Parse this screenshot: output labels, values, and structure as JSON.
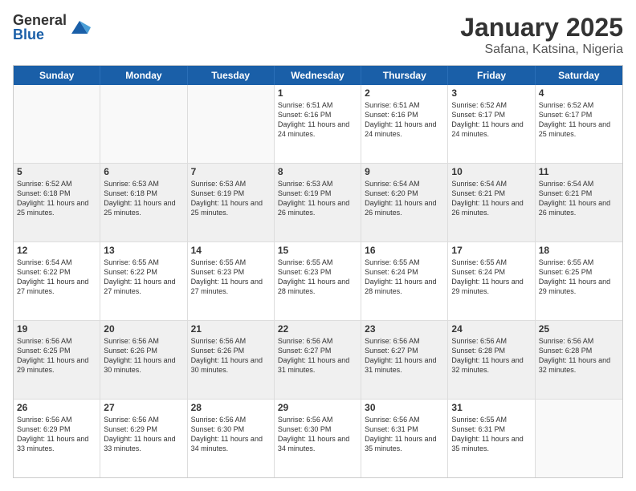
{
  "header": {
    "logo_general": "General",
    "logo_blue": "Blue",
    "main_title": "January 2025",
    "sub_title": "Safana, Katsina, Nigeria"
  },
  "days_of_week": [
    "Sunday",
    "Monday",
    "Tuesday",
    "Wednesday",
    "Thursday",
    "Friday",
    "Saturday"
  ],
  "weeks": [
    [
      {
        "day": "",
        "sunrise": "",
        "sunset": "",
        "daylight": "",
        "empty": true
      },
      {
        "day": "",
        "sunrise": "",
        "sunset": "",
        "daylight": "",
        "empty": true
      },
      {
        "day": "",
        "sunrise": "",
        "sunset": "",
        "daylight": "",
        "empty": true
      },
      {
        "day": "1",
        "sunrise": "Sunrise: 6:51 AM",
        "sunset": "Sunset: 6:16 PM",
        "daylight": "Daylight: 11 hours and 24 minutes.",
        "empty": false
      },
      {
        "day": "2",
        "sunrise": "Sunrise: 6:51 AM",
        "sunset": "Sunset: 6:16 PM",
        "daylight": "Daylight: 11 hours and 24 minutes.",
        "empty": false
      },
      {
        "day": "3",
        "sunrise": "Sunrise: 6:52 AM",
        "sunset": "Sunset: 6:17 PM",
        "daylight": "Daylight: 11 hours and 24 minutes.",
        "empty": false
      },
      {
        "day": "4",
        "sunrise": "Sunrise: 6:52 AM",
        "sunset": "Sunset: 6:17 PM",
        "daylight": "Daylight: 11 hours and 25 minutes.",
        "empty": false
      }
    ],
    [
      {
        "day": "5",
        "sunrise": "Sunrise: 6:52 AM",
        "sunset": "Sunset: 6:18 PM",
        "daylight": "Daylight: 11 hours and 25 minutes.",
        "empty": false
      },
      {
        "day": "6",
        "sunrise": "Sunrise: 6:53 AM",
        "sunset": "Sunset: 6:18 PM",
        "daylight": "Daylight: 11 hours and 25 minutes.",
        "empty": false
      },
      {
        "day": "7",
        "sunrise": "Sunrise: 6:53 AM",
        "sunset": "Sunset: 6:19 PM",
        "daylight": "Daylight: 11 hours and 25 minutes.",
        "empty": false
      },
      {
        "day": "8",
        "sunrise": "Sunrise: 6:53 AM",
        "sunset": "Sunset: 6:19 PM",
        "daylight": "Daylight: 11 hours and 26 minutes.",
        "empty": false
      },
      {
        "day": "9",
        "sunrise": "Sunrise: 6:54 AM",
        "sunset": "Sunset: 6:20 PM",
        "daylight": "Daylight: 11 hours and 26 minutes.",
        "empty": false
      },
      {
        "day": "10",
        "sunrise": "Sunrise: 6:54 AM",
        "sunset": "Sunset: 6:21 PM",
        "daylight": "Daylight: 11 hours and 26 minutes.",
        "empty": false
      },
      {
        "day": "11",
        "sunrise": "Sunrise: 6:54 AM",
        "sunset": "Sunset: 6:21 PM",
        "daylight": "Daylight: 11 hours and 26 minutes.",
        "empty": false
      }
    ],
    [
      {
        "day": "12",
        "sunrise": "Sunrise: 6:54 AM",
        "sunset": "Sunset: 6:22 PM",
        "daylight": "Daylight: 11 hours and 27 minutes.",
        "empty": false
      },
      {
        "day": "13",
        "sunrise": "Sunrise: 6:55 AM",
        "sunset": "Sunset: 6:22 PM",
        "daylight": "Daylight: 11 hours and 27 minutes.",
        "empty": false
      },
      {
        "day": "14",
        "sunrise": "Sunrise: 6:55 AM",
        "sunset": "Sunset: 6:23 PM",
        "daylight": "Daylight: 11 hours and 27 minutes.",
        "empty": false
      },
      {
        "day": "15",
        "sunrise": "Sunrise: 6:55 AM",
        "sunset": "Sunset: 6:23 PM",
        "daylight": "Daylight: 11 hours and 28 minutes.",
        "empty": false
      },
      {
        "day": "16",
        "sunrise": "Sunrise: 6:55 AM",
        "sunset": "Sunset: 6:24 PM",
        "daylight": "Daylight: 11 hours and 28 minutes.",
        "empty": false
      },
      {
        "day": "17",
        "sunrise": "Sunrise: 6:55 AM",
        "sunset": "Sunset: 6:24 PM",
        "daylight": "Daylight: 11 hours and 29 minutes.",
        "empty": false
      },
      {
        "day": "18",
        "sunrise": "Sunrise: 6:55 AM",
        "sunset": "Sunset: 6:25 PM",
        "daylight": "Daylight: 11 hours and 29 minutes.",
        "empty": false
      }
    ],
    [
      {
        "day": "19",
        "sunrise": "Sunrise: 6:56 AM",
        "sunset": "Sunset: 6:25 PM",
        "daylight": "Daylight: 11 hours and 29 minutes.",
        "empty": false
      },
      {
        "day": "20",
        "sunrise": "Sunrise: 6:56 AM",
        "sunset": "Sunset: 6:26 PM",
        "daylight": "Daylight: 11 hours and 30 minutes.",
        "empty": false
      },
      {
        "day": "21",
        "sunrise": "Sunrise: 6:56 AM",
        "sunset": "Sunset: 6:26 PM",
        "daylight": "Daylight: 11 hours and 30 minutes.",
        "empty": false
      },
      {
        "day": "22",
        "sunrise": "Sunrise: 6:56 AM",
        "sunset": "Sunset: 6:27 PM",
        "daylight": "Daylight: 11 hours and 31 minutes.",
        "empty": false
      },
      {
        "day": "23",
        "sunrise": "Sunrise: 6:56 AM",
        "sunset": "Sunset: 6:27 PM",
        "daylight": "Daylight: 11 hours and 31 minutes.",
        "empty": false
      },
      {
        "day": "24",
        "sunrise": "Sunrise: 6:56 AM",
        "sunset": "Sunset: 6:28 PM",
        "daylight": "Daylight: 11 hours and 32 minutes.",
        "empty": false
      },
      {
        "day": "25",
        "sunrise": "Sunrise: 6:56 AM",
        "sunset": "Sunset: 6:28 PM",
        "daylight": "Daylight: 11 hours and 32 minutes.",
        "empty": false
      }
    ],
    [
      {
        "day": "26",
        "sunrise": "Sunrise: 6:56 AM",
        "sunset": "Sunset: 6:29 PM",
        "daylight": "Daylight: 11 hours and 33 minutes.",
        "empty": false
      },
      {
        "day": "27",
        "sunrise": "Sunrise: 6:56 AM",
        "sunset": "Sunset: 6:29 PM",
        "daylight": "Daylight: 11 hours and 33 minutes.",
        "empty": false
      },
      {
        "day": "28",
        "sunrise": "Sunrise: 6:56 AM",
        "sunset": "Sunset: 6:30 PM",
        "daylight": "Daylight: 11 hours and 34 minutes.",
        "empty": false
      },
      {
        "day": "29",
        "sunrise": "Sunrise: 6:56 AM",
        "sunset": "Sunset: 6:30 PM",
        "daylight": "Daylight: 11 hours and 34 minutes.",
        "empty": false
      },
      {
        "day": "30",
        "sunrise": "Sunrise: 6:56 AM",
        "sunset": "Sunset: 6:31 PM",
        "daylight": "Daylight: 11 hours and 35 minutes.",
        "empty": false
      },
      {
        "day": "31",
        "sunrise": "Sunrise: 6:55 AM",
        "sunset": "Sunset: 6:31 PM",
        "daylight": "Daylight: 11 hours and 35 minutes.",
        "empty": false
      },
      {
        "day": "",
        "sunrise": "",
        "sunset": "",
        "daylight": "",
        "empty": true
      }
    ]
  ]
}
